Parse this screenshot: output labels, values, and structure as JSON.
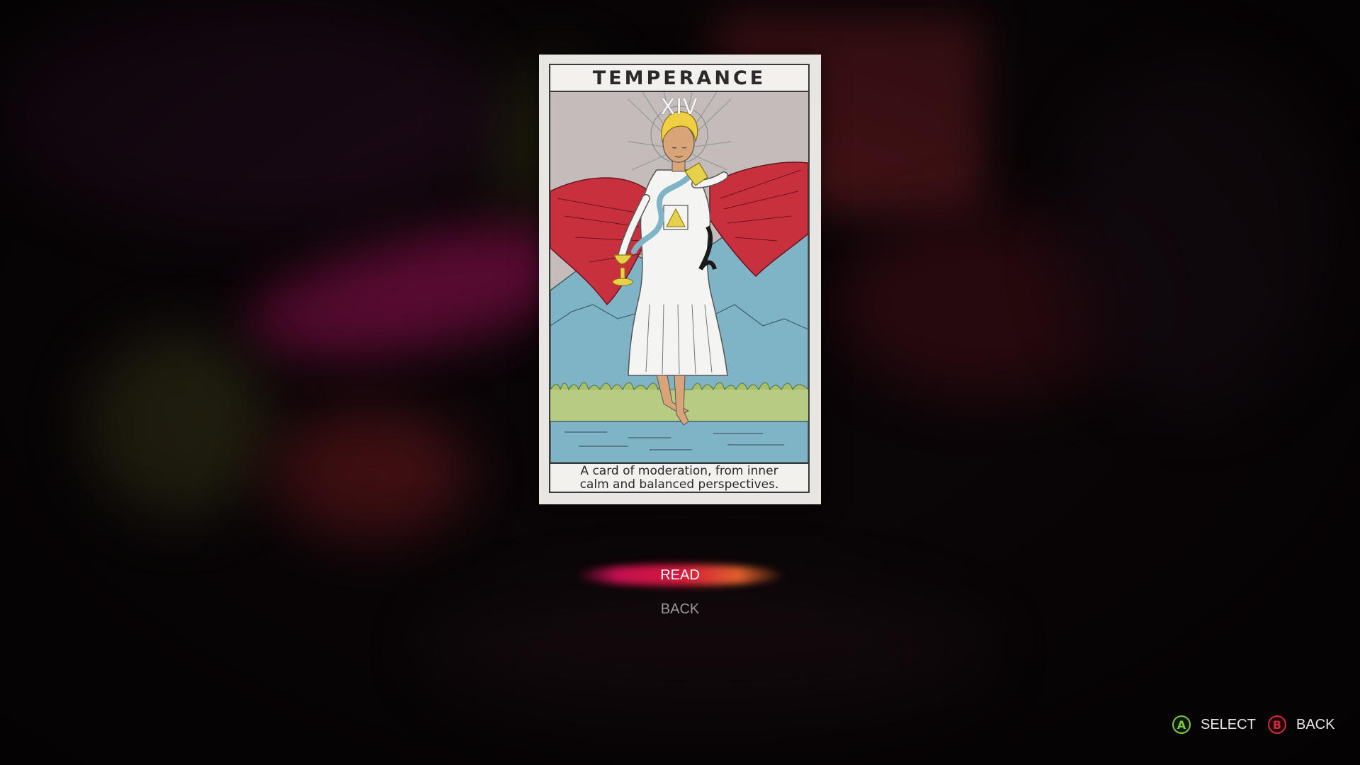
{
  "card": {
    "title": "TEMPERANCE",
    "numeral": "XIV",
    "description_line1": "A card of moderation, from inner",
    "description_line2": "calm and balanced perspectives.",
    "illustration": "angel-pouring-water-between-cups-icon"
  },
  "menu": {
    "items": [
      {
        "label": "READ",
        "selected": true
      },
      {
        "label": "BACK",
        "selected": false
      }
    ]
  },
  "controls": {
    "select_button": "A",
    "select_label": "SELECT",
    "back_button": "B",
    "back_label": "BACK"
  },
  "colors": {
    "accent_gradient_start": "#c2104f",
    "accent_gradient_end": "#e0602a",
    "a_button": "#7ac943",
    "b_button": "#d02a3c"
  }
}
